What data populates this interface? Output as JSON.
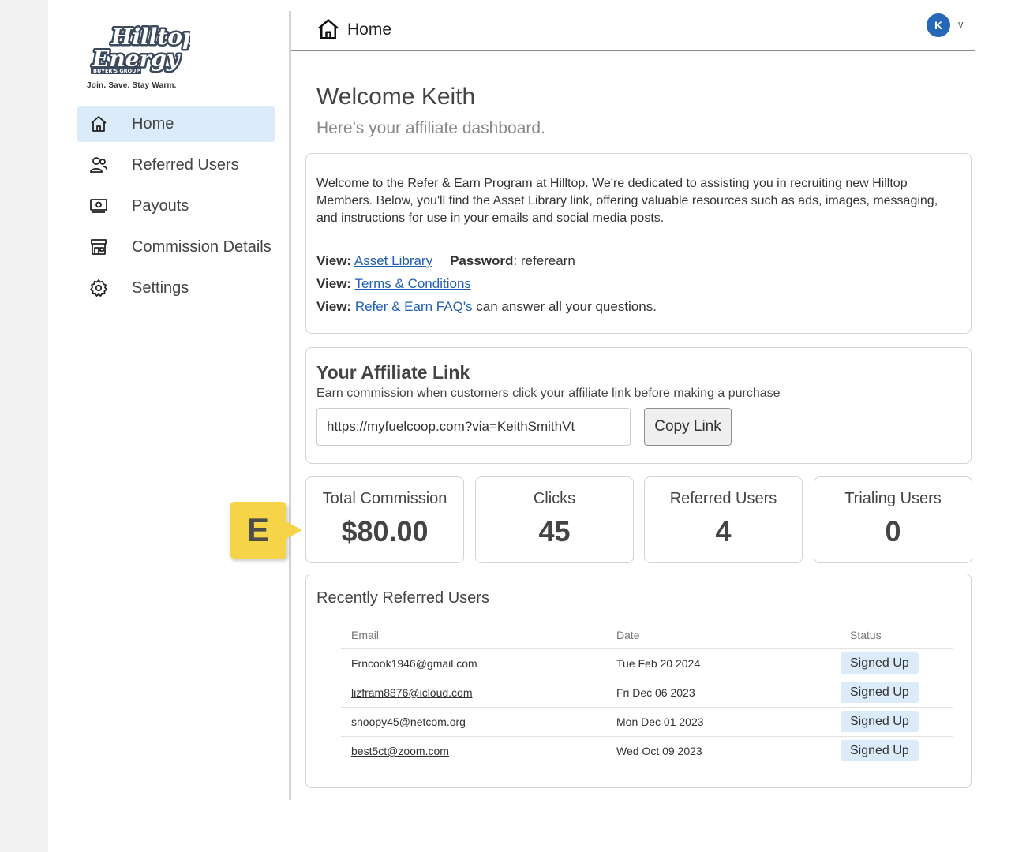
{
  "brand": {
    "logo_line1": "Hilltop",
    "logo_line2": "Energy",
    "logo_ribbon": "BUYER'S GROUP",
    "tagline": "Join. Save. Stay Warm."
  },
  "sidebar": {
    "items": [
      {
        "label": "Home",
        "icon": "home-icon",
        "active": true
      },
      {
        "label": "Referred Users",
        "icon": "users-icon",
        "active": false
      },
      {
        "label": "Payouts",
        "icon": "money-icon",
        "active": false
      },
      {
        "label": "Commission Details",
        "icon": "store-icon",
        "active": false
      },
      {
        "label": "Settings",
        "icon": "gear-icon",
        "active": false
      }
    ]
  },
  "header": {
    "title": "Home",
    "avatar_initial": "K",
    "avatar_caret": "v",
    "avatar_color": "#2667b8"
  },
  "welcome": {
    "title": "Welcome Keith",
    "subtitle": "Here’s your affiliate dashboard."
  },
  "intro": {
    "text": "Welcome to the Refer & Earn Program at Hilltop. We're dedicated to assisting you in recruiting new Hilltop Members. Below, you'll find the Asset Library link, offering valuable resources such as ads, images, messaging, and instructions for use in your emails and social media posts.",
    "view_label": "View:",
    "asset_library_link": "Asset Library",
    "password_label": "Password",
    "password_value": ": referearn",
    "terms_link": "Terms & Conditions",
    "faq_link": " Refer & Earn FAQ's",
    "faq_suffix": " can answer all your questions."
  },
  "affiliate": {
    "title": "Your Affiliate Link",
    "description": "Earn commission when customers click your affiliate link before making a purchase",
    "link_value": "https://myfuelcoop.com?via=KeithSmithVt",
    "copy_label": "Copy Link"
  },
  "stats": [
    {
      "label": "Total Commission",
      "value": "$80.00"
    },
    {
      "label": "Clicks",
      "value": "45"
    },
    {
      "label": "Referred Users",
      "value": "4"
    },
    {
      "label": "Trialing Users",
      "value": "0"
    }
  ],
  "callout": {
    "letter": "E",
    "color": "#f5d547"
  },
  "recent": {
    "title": "Recently Referred Users",
    "columns": [
      "Email",
      "Date",
      "Status"
    ],
    "rows": [
      {
        "email": "Frncook1946@gmail.com",
        "date": "Tue Feb 20 2024",
        "status": "Signed Up"
      },
      {
        "email": "lizfram8876@icloud.com",
        "date": "Fri Dec 06 2023",
        "status": "Signed Up"
      },
      {
        "email": "snoopy45@netcom.org",
        "date": "Mon Dec 01 2023",
        "status": "Signed Up"
      },
      {
        "email": "best5ct@zoom.com",
        "date": "Wed Oct 09 2023",
        "status": "Signed Up"
      }
    ]
  }
}
